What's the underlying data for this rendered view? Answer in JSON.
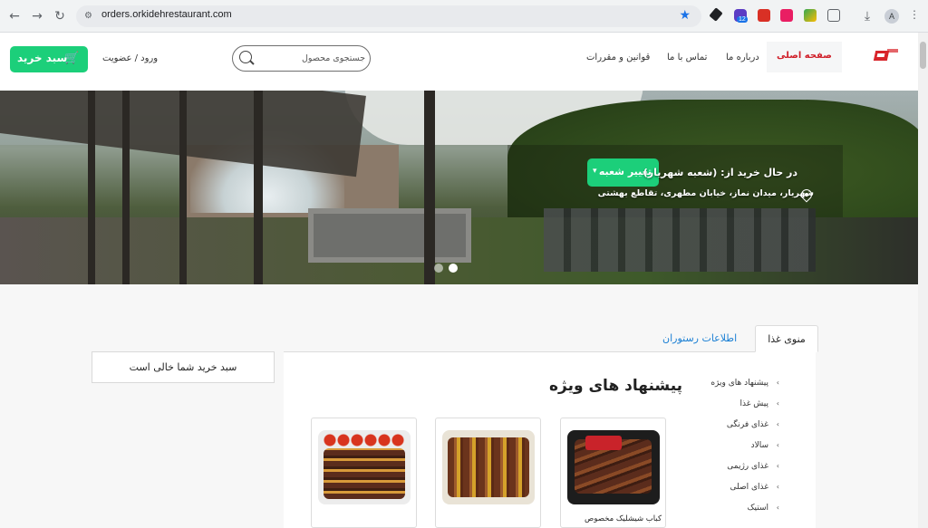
{
  "browser": {
    "url": "orders.orkidehrestaurant.com",
    "extension_badge": "12",
    "profile_initial": "A"
  },
  "header": {
    "cart_button": "سبد خرید",
    "login": "ورود / عضویت",
    "search_placeholder": "جستجوی محصول",
    "menu": {
      "home": "صفحه اصلی",
      "about": "درباره ما",
      "contact": "تماس با ما",
      "rules": "قوانین و مقررات"
    }
  },
  "hero": {
    "buying_from": "در حال خرید از: (شعبه شهریار)",
    "change_branch": "تغییر شعبه",
    "address": "شهریار، میدان نماز، خیابان مطهری، تقاطع بهشتی",
    "slides_total": 2,
    "active_slide": 1
  },
  "tabs": {
    "food_menu": "منوی غذا",
    "restaurant_info": "اطلاعات رستوران"
  },
  "cart": {
    "empty_message": "سبد خرید شما خالی است"
  },
  "categories": [
    "پیشنهاد های ویژه",
    "پیش غذا",
    "غذای فرنگی",
    "سالاد",
    "غذای رژیمی",
    "غذای اصلی",
    "استیک"
  ],
  "section_title": "پیشنهاد های ویژه",
  "products": [
    {
      "name": "کباب شیشلیک مخصوص"
    },
    {
      "name": ""
    },
    {
      "name": ""
    }
  ],
  "colors": {
    "accent_green": "#1ccf7a",
    "active_menu_red": "#d0202a",
    "info_tab_blue": "#1a7fd4"
  }
}
